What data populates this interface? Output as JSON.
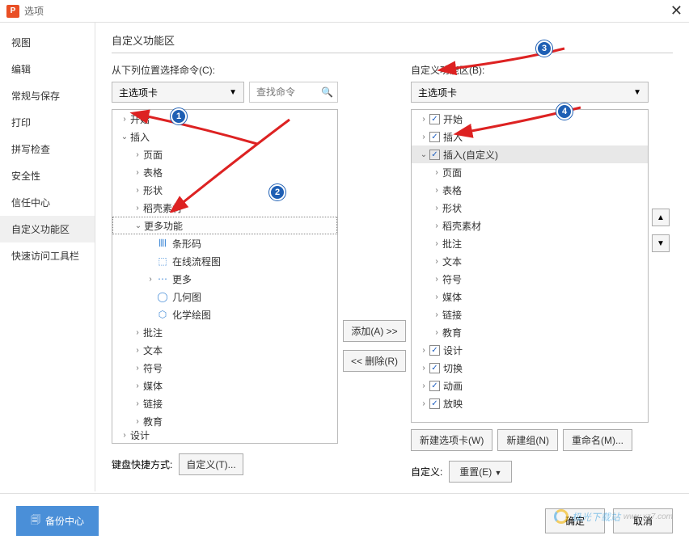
{
  "window": {
    "title": "选项"
  },
  "sidebar": {
    "items": [
      {
        "label": "视图"
      },
      {
        "label": "编辑"
      },
      {
        "label": "常规与保存"
      },
      {
        "label": "打印"
      },
      {
        "label": "拼写检查"
      },
      {
        "label": "安全性"
      },
      {
        "label": "信任中心"
      },
      {
        "label": "自定义功能区"
      },
      {
        "label": "快速访问工具栏"
      }
    ],
    "selectedIndex": 7
  },
  "content": {
    "title": "自定义功能区",
    "left": {
      "label": "从下列位置选择命令(C):",
      "dropdown": "主选项卡",
      "searchPlaceholder": "查找命令",
      "tree": [
        {
          "ind": 0,
          "exp": ">",
          "label": "开始"
        },
        {
          "ind": 0,
          "exp": "v",
          "label": "插入",
          "sel": false
        },
        {
          "ind": 1,
          "exp": ">",
          "label": "页面"
        },
        {
          "ind": 1,
          "exp": ">",
          "label": "表格"
        },
        {
          "ind": 1,
          "exp": ">",
          "label": "形状"
        },
        {
          "ind": 1,
          "exp": ">",
          "label": "稻壳素材"
        },
        {
          "ind": 1,
          "exp": "v",
          "label": "更多功能",
          "sel": true
        },
        {
          "ind": 2,
          "exp": "",
          "label": "条形码",
          "icon": "barcode"
        },
        {
          "ind": 2,
          "exp": "",
          "label": "在线流程图",
          "icon": "flow"
        },
        {
          "ind": 2,
          "exp": ">",
          "label": "更多",
          "icon": "dots"
        },
        {
          "ind": 2,
          "exp": "",
          "label": "几何图",
          "icon": "geo"
        },
        {
          "ind": 2,
          "exp": "",
          "label": "化学绘图",
          "icon": "chem"
        },
        {
          "ind": 1,
          "exp": ">",
          "label": "批注"
        },
        {
          "ind": 1,
          "exp": ">",
          "label": "文本"
        },
        {
          "ind": 1,
          "exp": ">",
          "label": "符号"
        },
        {
          "ind": 1,
          "exp": ">",
          "label": "媒体"
        },
        {
          "ind": 1,
          "exp": ">",
          "label": "链接"
        },
        {
          "ind": 1,
          "exp": ">",
          "label": "教育"
        },
        {
          "ind": 0,
          "exp": ">",
          "label": "设计",
          "cut": true
        }
      ]
    },
    "right": {
      "label": "自定义功能区(B):",
      "dropdown": "主选项卡",
      "tree": [
        {
          "ind": 0,
          "exp": ">",
          "chk": true,
          "label": "开始"
        },
        {
          "ind": 0,
          "exp": ">",
          "chk": true,
          "label": "插入"
        },
        {
          "ind": 0,
          "exp": "v",
          "chk": true,
          "label": "插入(自定义)",
          "sel": true
        },
        {
          "ind": 1,
          "exp": ">",
          "label": "页面"
        },
        {
          "ind": 1,
          "exp": ">",
          "label": "表格"
        },
        {
          "ind": 1,
          "exp": ">",
          "label": "形状"
        },
        {
          "ind": 1,
          "exp": ">",
          "label": "稻壳素材"
        },
        {
          "ind": 1,
          "exp": ">",
          "label": "批注"
        },
        {
          "ind": 1,
          "exp": ">",
          "label": "文本"
        },
        {
          "ind": 1,
          "exp": ">",
          "label": "符号"
        },
        {
          "ind": 1,
          "exp": ">",
          "label": "媒体"
        },
        {
          "ind": 1,
          "exp": ">",
          "label": "链接"
        },
        {
          "ind": 1,
          "exp": ">",
          "label": "教育"
        },
        {
          "ind": 0,
          "exp": ">",
          "chk": true,
          "label": "设计"
        },
        {
          "ind": 0,
          "exp": ">",
          "chk": true,
          "label": "切换"
        },
        {
          "ind": 0,
          "exp": ">",
          "chk": true,
          "label": "动画"
        },
        {
          "ind": 0,
          "exp": ">",
          "chk": true,
          "label": "放映"
        }
      ]
    },
    "buttons": {
      "add": "添加(A) >>",
      "remove": "<< 删除(R)",
      "newTab": "新建选项卡(W)",
      "newGroup": "新建组(N)",
      "rename": "重命名(M)...",
      "kbLabel": "键盘快捷方式:",
      "kbCustom": "自定义(T)...",
      "customLabel": "自定义:",
      "reset": "重置(E)"
    }
  },
  "footer": {
    "backup": "备份中心",
    "ok": "确定",
    "cancel": "取消"
  },
  "watermark": "极光下载站",
  "badges": [
    "1",
    "2",
    "3",
    "4"
  ]
}
